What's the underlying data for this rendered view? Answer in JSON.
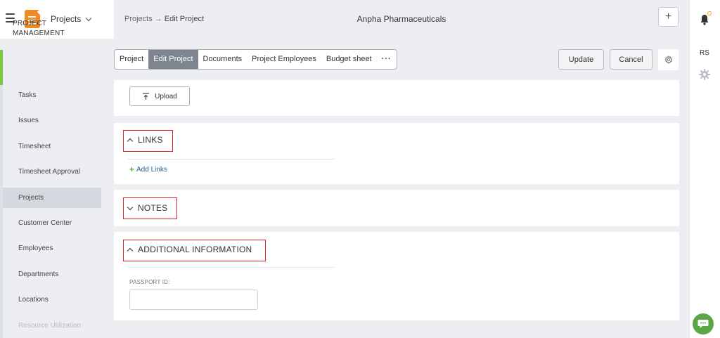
{
  "header": {
    "module_label": "Projects",
    "breadcrumb": {
      "parent": "Projects",
      "arrow": "→",
      "current": "Edit Project"
    },
    "company_name": "Anpha Pharmaceuticals",
    "plus_label": "+"
  },
  "right_rail": {
    "avatar_initials": "RS"
  },
  "sidebar": {
    "section_title_line1": "PROJECT",
    "section_title_line2": "MANAGEMENT",
    "items": [
      {
        "label": "Tasks"
      },
      {
        "label": "Issues"
      },
      {
        "label": "Timesheet"
      },
      {
        "label": "Timesheet Approval"
      },
      {
        "label": "Projects"
      },
      {
        "label": "Customer Center"
      },
      {
        "label": "Employees"
      },
      {
        "label": "Departments"
      },
      {
        "label": "Locations"
      },
      {
        "label": "Resource Utilization"
      }
    ]
  },
  "toolbar": {
    "tabs": [
      {
        "label": "Project"
      },
      {
        "label": "Edit Project"
      },
      {
        "label": "Documents"
      },
      {
        "label": "Project Employees"
      },
      {
        "label": "Budget sheet"
      },
      {
        "label": "···"
      }
    ],
    "update_label": "Update",
    "cancel_label": "Cancel"
  },
  "documents": {
    "upload_label": "Upload"
  },
  "links": {
    "heading": "LINKS",
    "add_label": "Add Links"
  },
  "notes": {
    "heading": "NOTES"
  },
  "additional_info": {
    "heading": "ADDITIONAL INFORMATION",
    "passport_label": "PASSPORT ID:",
    "passport_value": ""
  },
  "colors": {
    "accent_green": "#7dc642",
    "active_tab": "#7d8590",
    "highlight_red": "#d9262c",
    "logo_orange": "#f08a24",
    "chat_green": "#5aa845"
  }
}
